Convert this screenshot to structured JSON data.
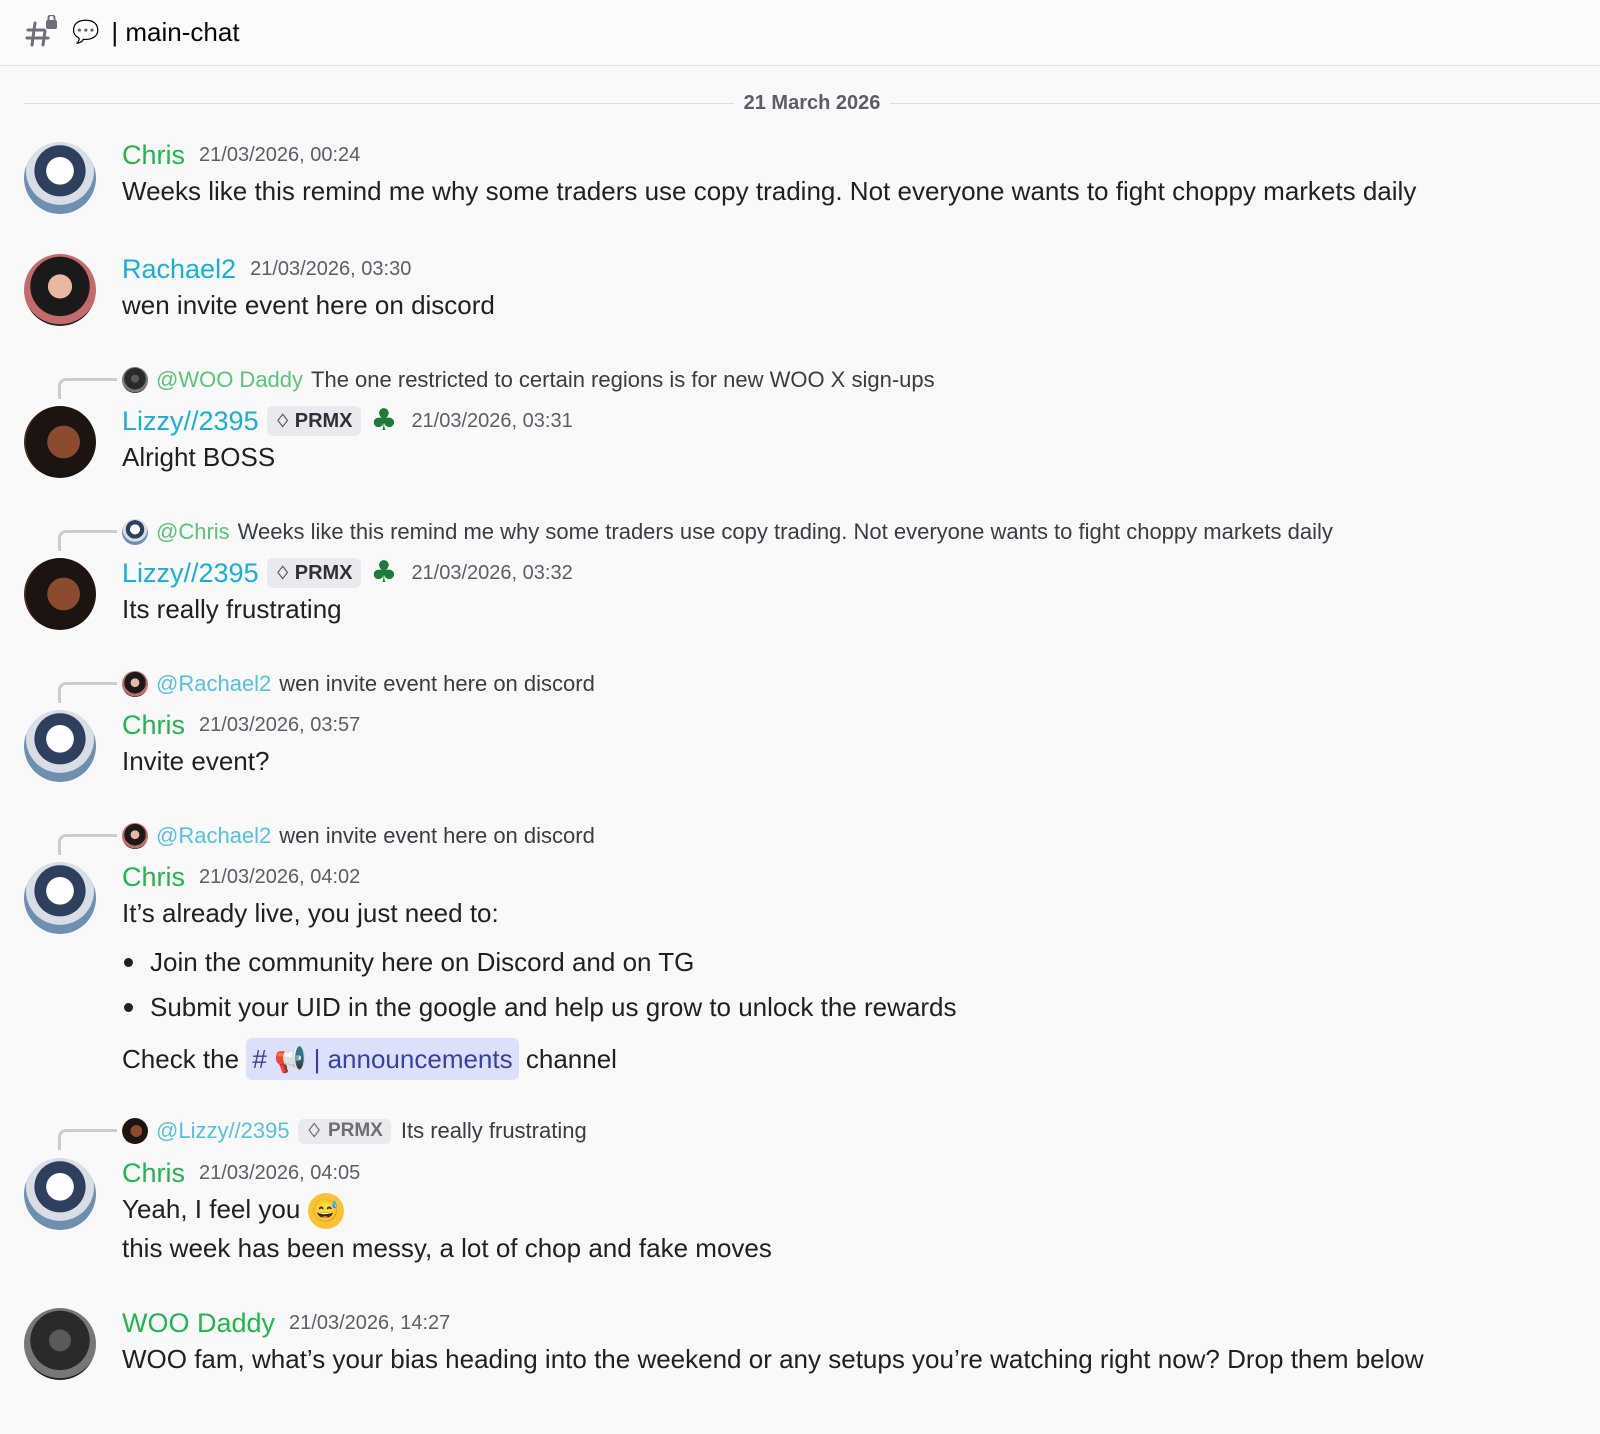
{
  "header": {
    "channel_name": "main-chat",
    "hash_icon": "hash-lock-icon",
    "bubble_icon": "speech-bubble-icon"
  },
  "date_divider": "21 March 2026",
  "messages": [
    {
      "username": "Chris",
      "timestamp": "21/03/2026, 00:24",
      "text": "Weeks like this remind me why some traders use copy trading. Not everyone wants to fight choppy markets daily"
    },
    {
      "username": "Rachael2",
      "timestamp": "21/03/2026, 03:30",
      "text": "wen invite event here on discord"
    },
    {
      "reply": {
        "mention": "@WOO Daddy",
        "text": "The one restricted to certain regions is for new WOO X sign-ups"
      },
      "username": "Lizzy//2395",
      "badge": "PRMX",
      "timestamp": "21/03/2026, 03:31",
      "text": "Alright BOSS"
    },
    {
      "reply": {
        "mention": "@Chris",
        "text": "Weeks like this remind me why some traders use copy trading. Not everyone wants to fight choppy markets daily"
      },
      "username": "Lizzy//2395",
      "badge": "PRMX",
      "timestamp": "21/03/2026, 03:32",
      "text": "Its really frustrating"
    },
    {
      "reply": {
        "mention": "@Rachael2",
        "text": "wen invite event here on discord"
      },
      "username": "Chris",
      "timestamp": "21/03/2026, 03:57",
      "text": "Invite event?"
    },
    {
      "reply": {
        "mention": "@Rachael2",
        "text": "wen invite event here on discord"
      },
      "username": "Chris",
      "timestamp": "21/03/2026, 04:02",
      "text": "It’s already live, you just need to:",
      "bullets": [
        "Join the community here on Discord and on TG",
        "Submit your UID in the google and help us grow to unlock the rewards"
      ],
      "check_prefix": "Check the",
      "channel_link_hash": "#",
      "channel_link_name": "announcements",
      "check_suffix": "channel"
    },
    {
      "reply": {
        "mention": "@Lizzy//2395",
        "badge": "PRMX",
        "text": "Its really frustrating"
      },
      "username": "Chris",
      "timestamp": "21/03/2026, 04:05",
      "text": "Yeah, I feel you",
      "emoji": "sweat-smile-emoji",
      "text2": "this week has been messy, a lot of chop and fake moves"
    },
    {
      "username": "WOO Daddy",
      "timestamp": "21/03/2026, 14:27",
      "text": "WOO fam, what’s your bias heading into the weekend or any setups you’re watching right now? Drop them below"
    }
  ],
  "colors": {
    "chris": "#1fb64f",
    "rachael": "#15b0d9",
    "lizzy": "#15b0d9",
    "woo_daddy": "#1fb64f",
    "channel_mention_bg": "#dde0fb"
  }
}
